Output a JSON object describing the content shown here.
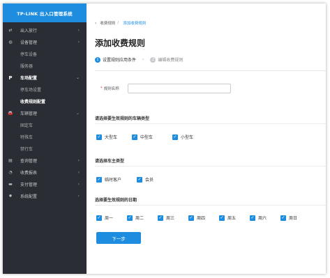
{
  "brand": {
    "title": "TP-LINK 出入口管理系统"
  },
  "sidebar": {
    "items": [
      {
        "label": "出入放行",
        "icon": "swap-icon",
        "glyph": "⇄",
        "arrow": "›"
      },
      {
        "label": "设备管理",
        "icon": "device-icon",
        "glyph": "◍",
        "arrow": "›"
      },
      {
        "label": "停车设备"
      },
      {
        "label": "服务器"
      },
      {
        "label": "车场配置",
        "icon": "parking-icon",
        "glyph": "P",
        "arrow": "⌄"
      },
      {
        "label": "停车场设置"
      },
      {
        "label": "收费规则配置"
      },
      {
        "label": "车辆管理",
        "icon": "car-icon",
        "glyph": "🚘",
        "arrow": "⌄"
      },
      {
        "label": "固定车"
      },
      {
        "label": "特殊车"
      },
      {
        "label": "禁行车"
      },
      {
        "label": "查询管理",
        "icon": "query-icon",
        "glyph": "▤",
        "arrow": "›"
      },
      {
        "label": "收费报表",
        "icon": "report-icon",
        "glyph": "◔",
        "arrow": "›"
      },
      {
        "label": "支付管理",
        "icon": "payment-icon",
        "glyph": "▬",
        "arrow": "›"
      },
      {
        "label": "系统配置",
        "icon": "settings-icon",
        "glyph": "✹",
        "arrow": "›"
      }
    ]
  },
  "breadcrumb": {
    "back": "‹",
    "parent": "收费规则",
    "sep": "/",
    "current": "添加收费规则"
  },
  "page": {
    "title": "添加收费规则"
  },
  "steps": [
    {
      "num": "1",
      "label": "设置规则应用条件"
    },
    {
      "num": "2",
      "label": "编辑收费规则"
    }
  ],
  "steps_arrow": "›",
  "form": {
    "rule_name_label": "规则名称",
    "rule_name_required": "*",
    "rule_name_value": ""
  },
  "vehicle_type": {
    "title": "请选择要生效规则的车辆类型",
    "options": [
      "大型车",
      "中型车",
      "小型车"
    ]
  },
  "owner_type": {
    "title": "请选择车主类型",
    "options": [
      "临时客户",
      "会员"
    ]
  },
  "weekday": {
    "title": "选择要生效规则的日期",
    "options": [
      "周一",
      "周二",
      "周三",
      "周四",
      "周五",
      "周六",
      "周日"
    ]
  },
  "check_glyph": "✓",
  "next_button": "下一步",
  "colors": {
    "accent": "#1e8de0",
    "sidebar_bg": "#2a2d33",
    "required": "#e0403d"
  }
}
